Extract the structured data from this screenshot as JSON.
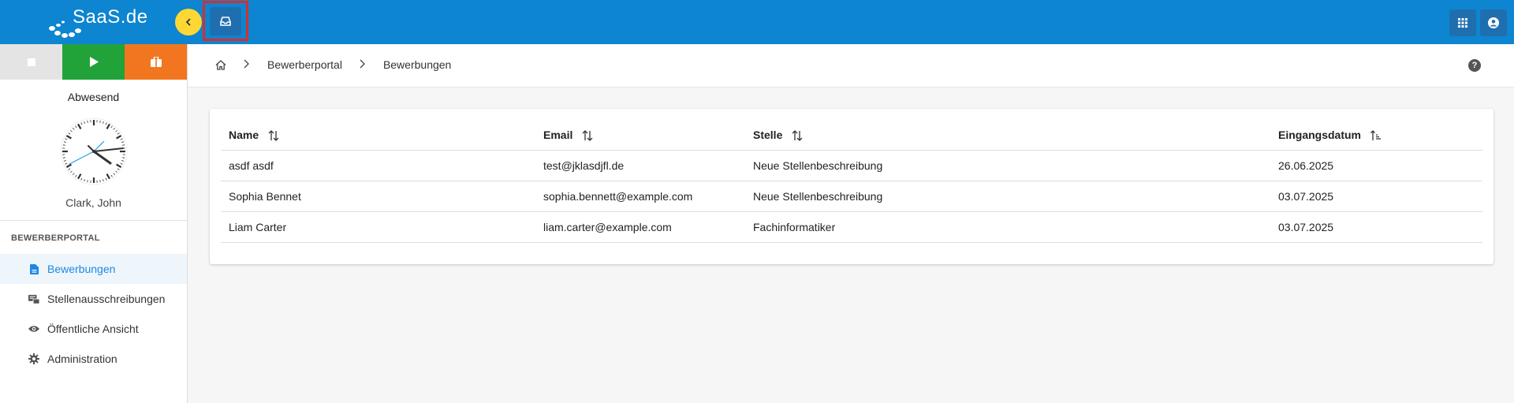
{
  "app": {
    "logo_text": "SaaS.de"
  },
  "time_tracking": {
    "status": "Abwesend",
    "user": "Clark, John"
  },
  "sidebar": {
    "section_title": "BEWERBERPORTAL",
    "items": [
      {
        "label": "Bewerbungen",
        "icon": "file-document-icon",
        "active": true
      },
      {
        "label": "Stellenausschreibungen",
        "icon": "job-listing-icon",
        "active": false
      },
      {
        "label": "Öffentliche Ansicht",
        "icon": "eye-icon",
        "active": false
      },
      {
        "label": "Administration",
        "icon": "gear-icon",
        "active": false
      }
    ]
  },
  "breadcrumb": {
    "items": [
      "Bewerberportal",
      "Bewerbungen"
    ]
  },
  "table": {
    "columns": [
      "Name",
      "Email",
      "Stelle",
      "Eingangsdatum"
    ],
    "rows": [
      [
        "asdf asdf",
        "test@jklasdjfl.de",
        "Neue Stellenbeschreibung",
        "26.06.2025"
      ],
      [
        "Sophia Bennet",
        "sophia.bennett@example.com",
        "Neue Stellenbeschreibung",
        "03.07.2025"
      ],
      [
        "Liam Carter",
        "liam.carter@example.com",
        "Fachinformatiker",
        "03.07.2025"
      ]
    ]
  },
  "colors": {
    "topbar": "#0d85d0",
    "accent": "#1e88e5",
    "play": "#22a33a",
    "pause": "#f2761f",
    "back": "#fdd835",
    "highlight_border": "#d32f2f"
  }
}
